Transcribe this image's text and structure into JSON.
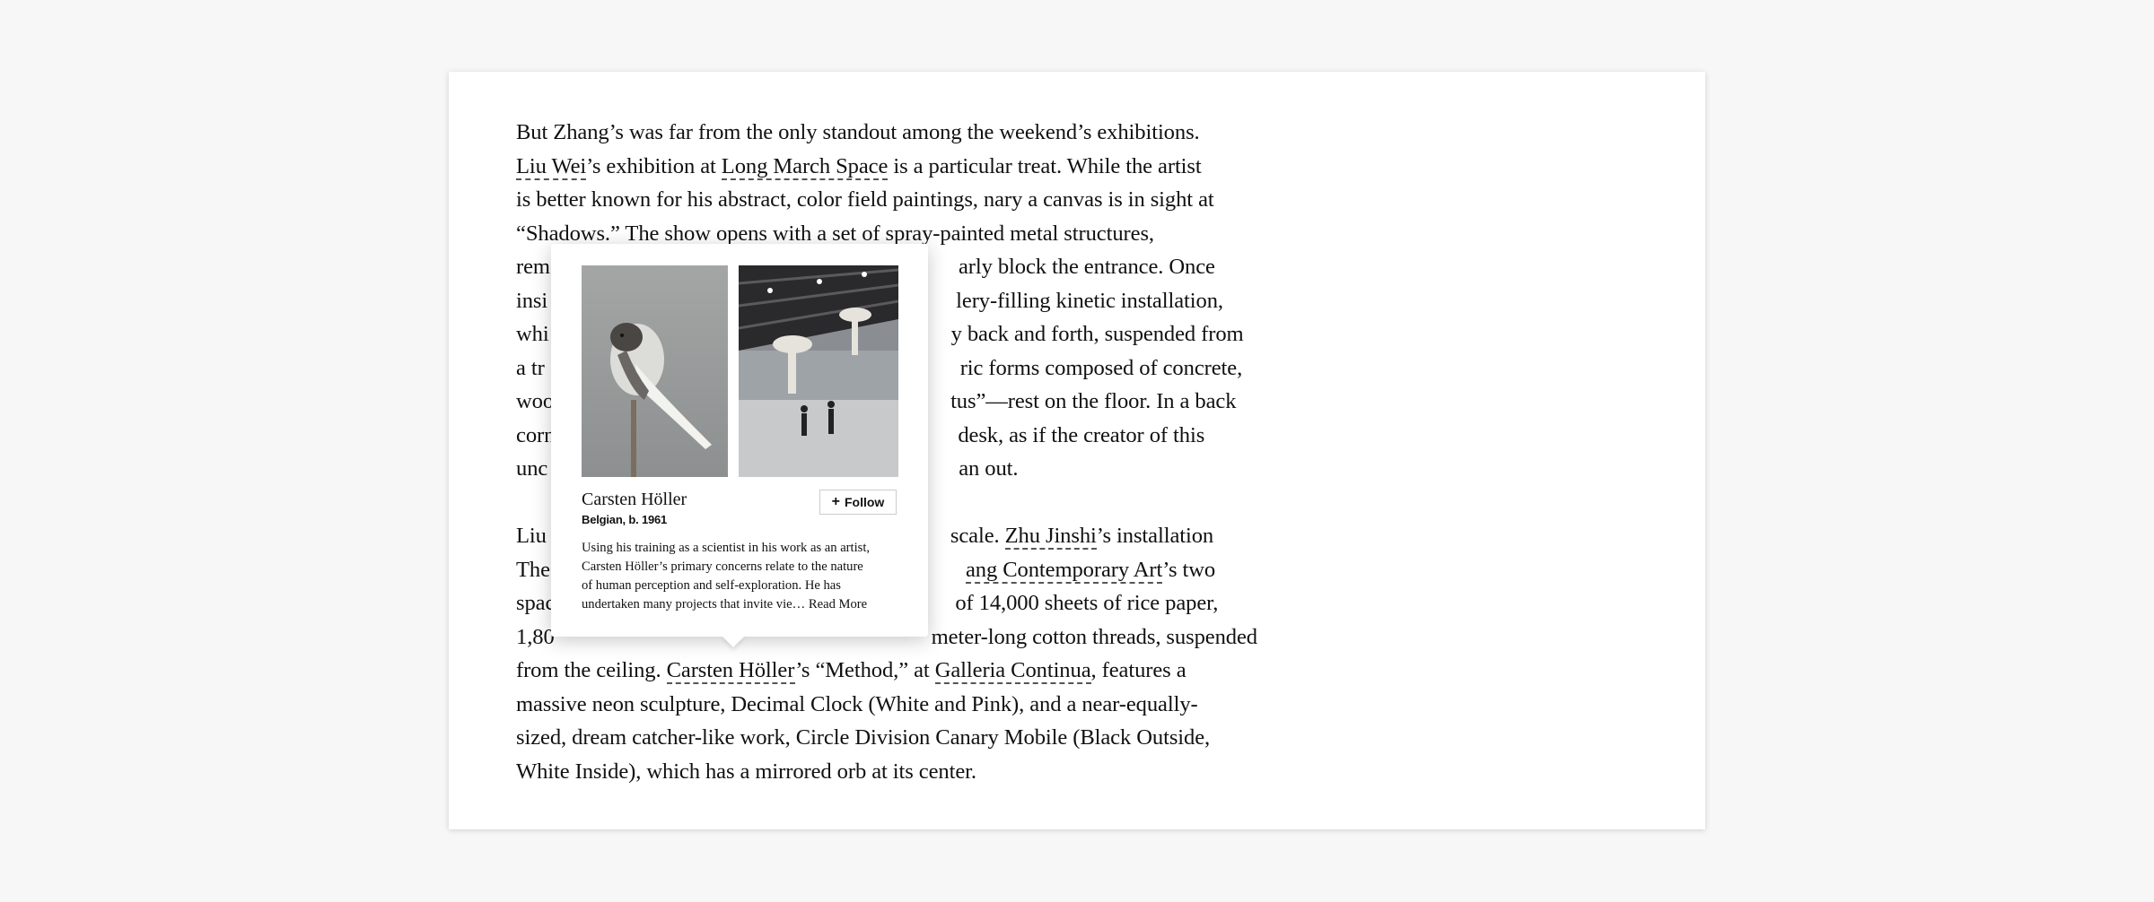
{
  "article": {
    "p1_lines": [
      [
        "But Zhang’s was far from the only standout among the weekend’s exhibitions."
      ],
      [
        "",
        "Liu Wei",
        "’s exhibition at ",
        "Long March Space",
        " is a particular treat. While the artist"
      ],
      [
        "is better known for his abstract, color field paintings, nary a canvas is in sight at"
      ],
      [
        "“Shadows.” The show opens with a set of spray-painted metal structures,"
      ],
      [
        "rem",
        "arly block the entrance. Once"
      ],
      [
        "insi",
        "lery-filling kinetic installation,"
      ],
      [
        "whi",
        "y back and forth, suspended from"
      ],
      [
        "a tr",
        "ric forms composed of concrete,"
      ],
      [
        "woo",
        "tus”—rest on the floor. In a back"
      ],
      [
        "corn",
        "desk, as if the creator of this"
      ],
      [
        "unc",
        "an out."
      ]
    ],
    "p2_lines": [
      [
        "Liu",
        "scale. ",
        "Zhu Jinshi",
        "’s installation"
      ],
      [
        "The",
        "ang Contemporary Art",
        "’s two"
      ],
      [
        "spac",
        "of 14,000 sheets of rice paper,"
      ],
      [
        "1,80",
        "meter-long cotton threads, suspended"
      ],
      [
        "from the ceiling. ",
        "Carsten Höller",
        "’s “Method,” at ",
        "Galleria Continua",
        ", features a"
      ],
      [
        "massive neon sculpture, Decimal Clock (White and Pink), and a near-equally-"
      ],
      [
        "sized, dream catcher-like work, Circle Division Canary Mobile (Black Outside,"
      ],
      [
        "White Inside), which has a mirrored orb at its center."
      ]
    ]
  },
  "popover": {
    "artist_name": "Carsten Höller",
    "artist_meta": "Belgian, b. 1961",
    "follow_label": "Follow",
    "bio_lines": [
      "Using his training as a scientist in his work as an artist,",
      "Carsten Höller’s primary concerns relate to the nature",
      "of human perception and self-exploration. He has",
      "undertaken many projects that invite vie…"
    ],
    "read_more": "Read More"
  },
  "colors": {
    "background": "#f7f7f7",
    "card": "#ffffff",
    "text": "#111111"
  }
}
